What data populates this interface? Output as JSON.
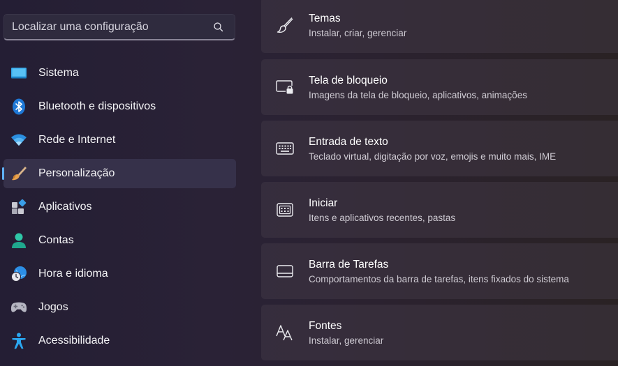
{
  "search": {
    "placeholder": "Localizar uma configuração"
  },
  "sidebar": {
    "items": [
      {
        "label": "Sistema",
        "icon": "monitor-icon"
      },
      {
        "label": "Bluetooth e dispositivos",
        "icon": "bluetooth-icon"
      },
      {
        "label": "Rede e Internet",
        "icon": "wifi-icon"
      },
      {
        "label": "Personalização",
        "icon": "paintbrush-icon",
        "active": true
      },
      {
        "label": "Aplicativos",
        "icon": "apps-icon"
      },
      {
        "label": "Contas",
        "icon": "account-icon"
      },
      {
        "label": "Hora e idioma",
        "icon": "globe-clock-icon"
      },
      {
        "label": "Jogos",
        "icon": "gamepad-icon"
      },
      {
        "label": "Acessibilidade",
        "icon": "accessibility-icon"
      }
    ]
  },
  "cards": [
    {
      "title": "Temas",
      "desc": "Instalar, criar, gerenciar",
      "icon": "brush-icon"
    },
    {
      "title": "Tela de bloqueio",
      "desc": "Imagens da tela de bloqueio, aplicativos, animações",
      "icon": "lock-screen-icon"
    },
    {
      "title": "Entrada de texto",
      "desc": "Teclado virtual, digitação por voz, emojis e muito mais, IME",
      "icon": "keyboard-icon"
    },
    {
      "title": "Iniciar",
      "desc": "Itens e aplicativos recentes, pastas",
      "icon": "start-menu-icon"
    },
    {
      "title": "Barra de Tarefas",
      "desc": "Comportamentos da barra de tarefas, itens fixados do sistema",
      "icon": "taskbar-icon"
    },
    {
      "title": "Fontes",
      "desc": "Instalar, gerenciar",
      "icon": "fonts-icon"
    }
  ],
  "colors": {
    "accent": "#5fb2ff",
    "active_item_bg": "#36314a",
    "card_bg": "#3a3340"
  }
}
